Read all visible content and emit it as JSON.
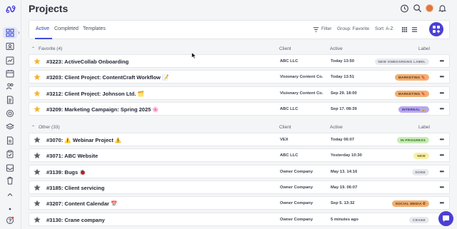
{
  "page": {
    "title": "Projects"
  },
  "rail": {
    "items": [
      "grid-icon",
      "user-card-icon",
      "chart-icon",
      "calendar-icon",
      "people-icon",
      "document-icon",
      "target-icon",
      "layers-icon",
      "file-icon",
      "clipboard-icon",
      "inbox-icon",
      "trash-icon",
      "chevron-up-icon",
      "dot-icon",
      "help-icon"
    ]
  },
  "toolbar": {
    "tabs": [
      "Active",
      "Completed",
      "Templates"
    ],
    "filter_label": "Filter",
    "group_label": "Group: Favorite",
    "sort_label": "Sort: A-Z"
  },
  "columns": {
    "client": "Client",
    "active": "Active",
    "label": "Label"
  },
  "sections": [
    {
      "title": "Favorite (4)",
      "rows": [
        {
          "name": "#3223: ActiveCollab Onboarding",
          "client": "ABC LLC",
          "active": "Today 13:50",
          "label": "NEW ONBOARDING LABEL",
          "label_bg": "#e9eaee",
          "label_fg": "#6a6f80",
          "starred": true
        },
        {
          "name": "#3203: Client Project: ContentCraft Workflow 📝",
          "client": "Visionary Content Co.",
          "active": "Today 13:51",
          "label": "MARKETING 🔖",
          "label_bg": "#f2ae6f",
          "label_fg": "#5a3510",
          "starred": true
        },
        {
          "name": "#3212: Client Project: Johnson Ltd. 🗂️",
          "client": "Visionary Content Co.",
          "active": "Sep 29. 18:00",
          "label": "MARKETING 🔖",
          "label_bg": "#f2ae6f",
          "label_fg": "#5a3510",
          "starred": true
        },
        {
          "name": "#3209: Marketing Campaign: Spring 2025 🌸",
          "client": "ABC LLC",
          "active": "Sep 17. 08:39",
          "label": "INTERNAL 🔒",
          "label_bg": "#b8a7ef",
          "label_fg": "#3a2a8a",
          "starred": true
        }
      ]
    },
    {
      "title": "Other (33)",
      "rows": [
        {
          "name": "#3070: ⚠️ Webinar Project ⚠️",
          "client": "VEX",
          "active": "Today 06:07",
          "label": "IN PROGRESS",
          "label_bg": "#c8ecb8",
          "label_fg": "#2f6a1c",
          "starred": false
        },
        {
          "name": "#3071: ABC Website",
          "client": "ABC LLC",
          "active": "Yesterday 10:30",
          "label": "NEW",
          "label_bg": "#f6f0a8",
          "label_fg": "#6a5a10",
          "starred": false
        },
        {
          "name": "#3139: Bugs 🐞",
          "client": "Owner Company",
          "active": "May 13. 14:16",
          "label": "DONE",
          "label_bg": "#e9eaee",
          "label_fg": "#6a6f80",
          "starred": false
        },
        {
          "name": "#3185: Client servicing",
          "client": "Owner Company",
          "active": "May 19. 06:07",
          "label": "",
          "label_bg": "",
          "label_fg": "",
          "starred": false
        },
        {
          "name": "#3207: Content Calendar 📅",
          "client": "Owner Company",
          "active": "Sep 5. 13:32",
          "label": "SOCIAL MEDIA ⏱",
          "label_bg": "#f2ae6f",
          "label_fg": "#5a3510",
          "starred": false
        },
        {
          "name": "#3130: Crane company",
          "client": "Owner Company",
          "active": "5 minutes ago",
          "label": "CRANE",
          "label_bg": "#e9eaee",
          "label_fg": "#6a6f80",
          "starred": false
        }
      ]
    }
  ],
  "colors": {
    "accent": "#3d4fd6",
    "star_on": "#f2b534",
    "star_off": "#5a5f6e"
  }
}
